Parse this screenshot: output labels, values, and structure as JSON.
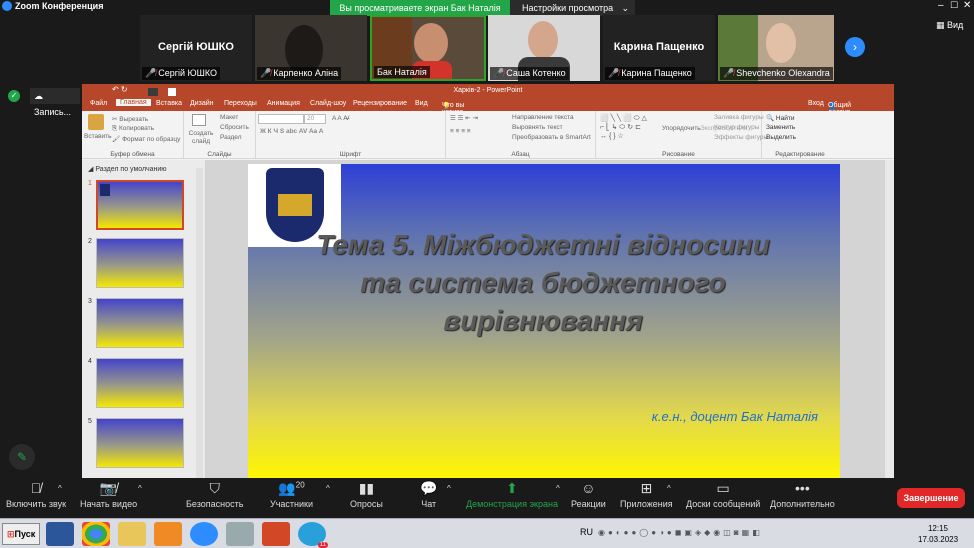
{
  "window": {
    "title": "Zoom Конференция",
    "share_banner": "Вы просматриваете экран Бак Наталія",
    "view_options": "Настройки просмотра",
    "view_button": "Вид"
  },
  "gallery": {
    "tiles": [
      {
        "big_name": "Сергій ЮШКО",
        "label": "Сергій ЮШКО"
      },
      {
        "label": "Карпенко Аліна"
      },
      {
        "label": "Бак Наталія"
      },
      {
        "label": "Саша Котенко"
      },
      {
        "big_name": "Карина Пащенко",
        "label": "Карина Пащенко"
      },
      {
        "label": "Shevchenko Olexandra"
      }
    ]
  },
  "recording": {
    "label": "Запись..."
  },
  "ppt": {
    "title": "Харків-2 - PowerPoint",
    "tabs": [
      "Файл",
      "Главная",
      "Вставка",
      "Дизайн",
      "Переходы",
      "Анимация",
      "Слайд-шоу",
      "Рецензирование",
      "Вид"
    ],
    "tell_me": "Что вы хотите сделать?",
    "login": "Вход",
    "share": "Общий доступ",
    "ribbon": {
      "paste": "Вставить",
      "cut": "Вырезать",
      "copy": "Копировать",
      "format_painter": "Формат по образцу",
      "clipboard": "Буфер обмена",
      "create_slide": "Создать слайд",
      "layout": "Макет",
      "reset": "Сбросить",
      "section": "Раздел",
      "slides": "Слайды",
      "font_size": "20",
      "font": "Шрифт",
      "text_direction": "Направление текста",
      "align_text": "Выровнять текст",
      "smartart": "Преобразовать в SmartArt",
      "paragraph": "Абзац",
      "arrange": "Упорядочить",
      "quick_styles": "Экспресс-стили",
      "shape_fill": "Заливка фигуры",
      "shape_outline": "Контур фигуры",
      "shape_effects": "Эффекты фигуры",
      "drawing": "Рисование",
      "find": "Найти",
      "replace": "Заменить",
      "select": "Выделить",
      "editing": "Редактирование"
    },
    "thumbs": {
      "section": "Раздел по умолчанию",
      "numbers": [
        "1",
        "2",
        "3",
        "4",
        "5"
      ]
    },
    "slide": {
      "title": "Тема 5. Міжбюджетні відносини та система бюджетного вирівнювання",
      "author": "к.е.н., доцент Бак Наталія"
    }
  },
  "toolbar": {
    "mute": "Включить звук",
    "video": "Начать видео",
    "security": "Безопасность",
    "participants": "Участники",
    "participants_count": "20",
    "polls": "Опросы",
    "chat": "Чат",
    "share": "Демонстрация экрана",
    "reactions": "Реакции",
    "apps": "Приложения",
    "whiteboards": "Доски сообщений",
    "more": "Дополнительно",
    "end": "Завершение"
  },
  "taskbar": {
    "start": "Пуск",
    "lang": "RU",
    "time": "12:15",
    "date": "17.03.2023",
    "badge": "11"
  }
}
